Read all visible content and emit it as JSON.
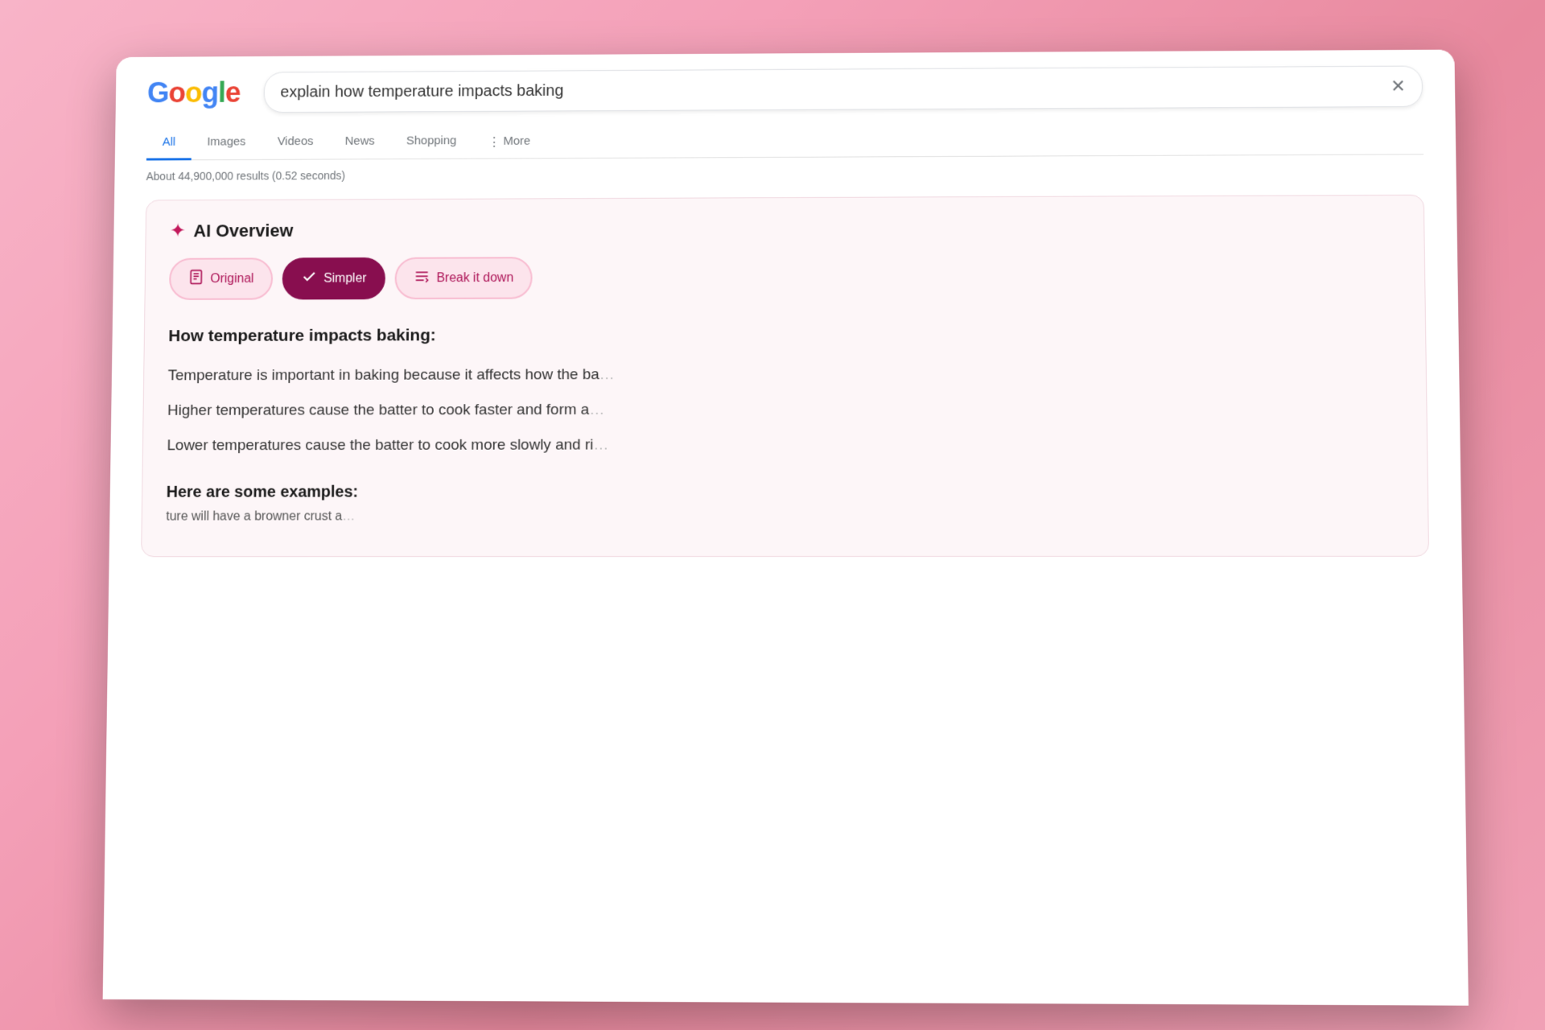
{
  "browser": {
    "close_icon": "✕"
  },
  "google": {
    "logo": "Google",
    "logo_letters": [
      "G",
      "o",
      "o",
      "g",
      "l",
      "e"
    ],
    "search_query": "explain how temperature impacts baking",
    "results_count": "About 44,900,000 results (0.52 seconds)",
    "close_icon": "✕"
  },
  "nav": {
    "tabs": [
      {
        "label": "All",
        "active": true
      },
      {
        "label": "Images",
        "active": false
      },
      {
        "label": "Videos",
        "active": false
      },
      {
        "label": "News",
        "active": false
      },
      {
        "label": "Shopping",
        "active": false
      }
    ],
    "more_label": "More",
    "more_icon": "⋮"
  },
  "ai_overview": {
    "title": "AI Overview",
    "sparkle_icon": "✦",
    "buttons": [
      {
        "label": "Original",
        "icon": "🗒",
        "type": "original"
      },
      {
        "label": "Simpler",
        "icon": "✓",
        "type": "simpler",
        "active": true
      },
      {
        "label": "Break it down",
        "icon": "≡",
        "type": "break"
      }
    ],
    "content": {
      "heading": "How temperature impacts baking:",
      "paragraphs": [
        "Temperature is important in baking because it affects how the ba",
        "Higher temperatures cause the batter to cook faster and form a",
        "Lower temperatures cause the batter to cook more slowly and ri"
      ],
      "examples_heading": "Here are some examples:",
      "footnote": "ture will have a browner crust a"
    }
  }
}
